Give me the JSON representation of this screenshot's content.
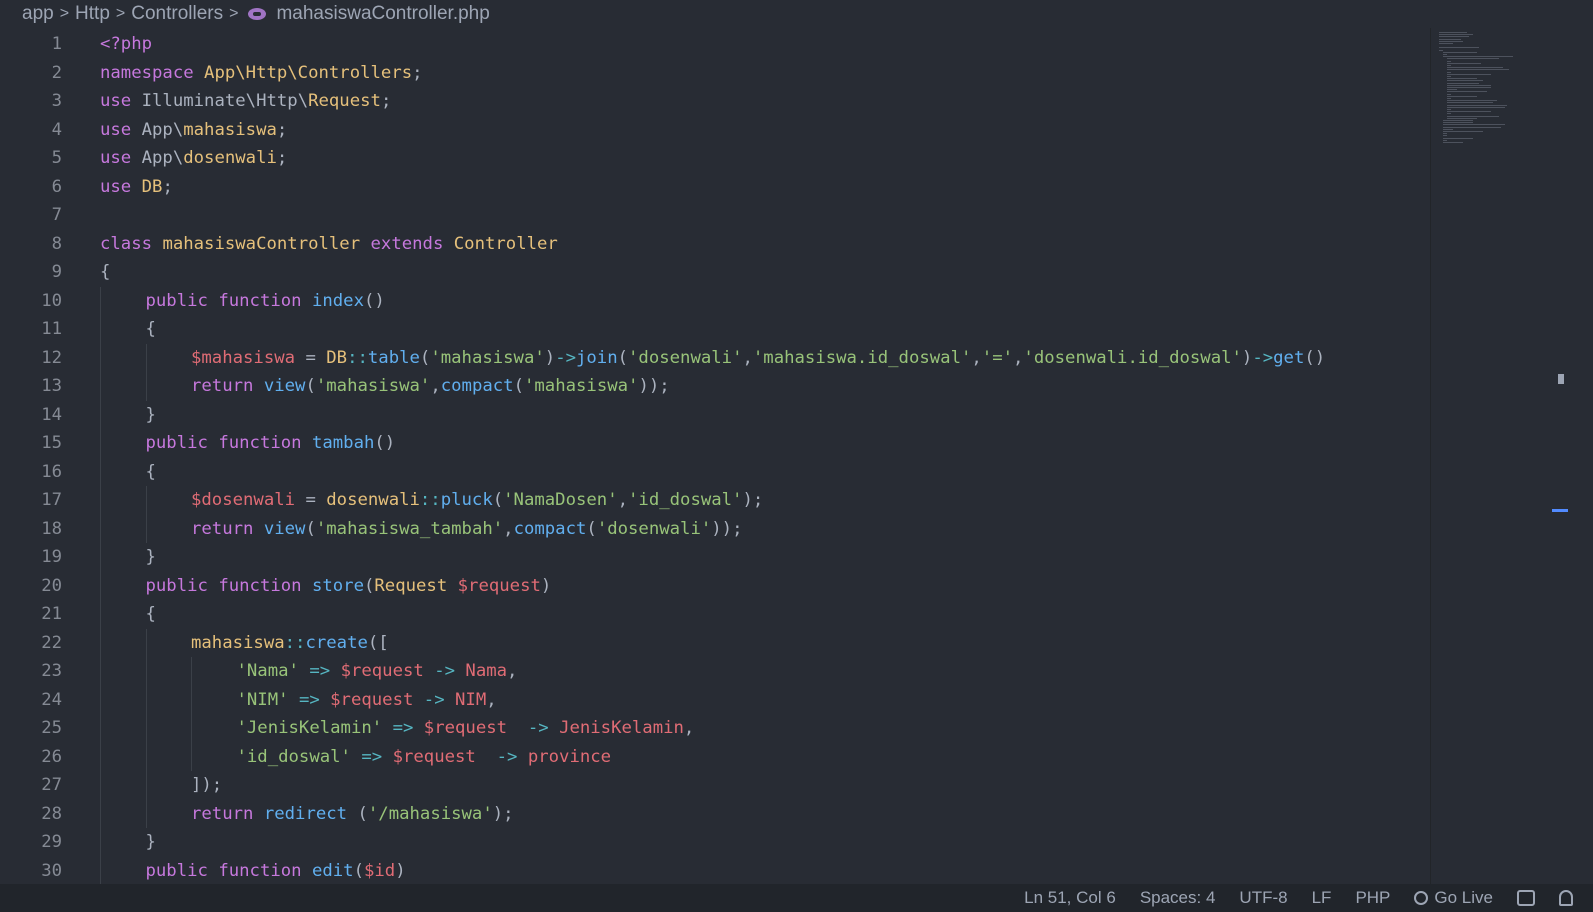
{
  "breadcrumb": {
    "items": [
      "app",
      "Http",
      "Controllers"
    ],
    "file": "mahasiswaController.php",
    "file_icon": "php-elephant-icon"
  },
  "editor": {
    "lines": [
      {
        "n": "1",
        "indent": 0,
        "tokens": [
          [
            "k",
            "<?php"
          ]
        ]
      },
      {
        "n": "2",
        "indent": 0,
        "tokens": [
          [
            "k",
            "namespace "
          ],
          [
            "c",
            "App\\Http\\Controllers"
          ],
          [
            "p",
            ";"
          ]
        ]
      },
      {
        "n": "3",
        "indent": 0,
        "tokens": [
          [
            "k",
            "use "
          ],
          [
            "p",
            "Illuminate\\Http\\"
          ],
          [
            "c",
            "Request"
          ],
          [
            "p",
            ";"
          ]
        ]
      },
      {
        "n": "4",
        "indent": 0,
        "tokens": [
          [
            "k",
            "use "
          ],
          [
            "p",
            "App\\"
          ],
          [
            "c",
            "mahasiswa"
          ],
          [
            "p",
            ";"
          ]
        ]
      },
      {
        "n": "5",
        "indent": 0,
        "tokens": [
          [
            "k",
            "use "
          ],
          [
            "p",
            "App\\"
          ],
          [
            "c",
            "dosenwali"
          ],
          [
            "p",
            ";"
          ]
        ]
      },
      {
        "n": "6",
        "indent": 0,
        "tokens": [
          [
            "k",
            "use "
          ],
          [
            "c",
            "DB"
          ],
          [
            "p",
            ";"
          ]
        ]
      },
      {
        "n": "7",
        "indent": 0,
        "tokens": []
      },
      {
        "n": "8",
        "indent": 0,
        "tokens": [
          [
            "k",
            "class "
          ],
          [
            "c",
            "mahasiswaController "
          ],
          [
            "k",
            "extends "
          ],
          [
            "c",
            "Controller"
          ]
        ]
      },
      {
        "n": "9",
        "indent": 0,
        "tokens": [
          [
            "p",
            "{"
          ]
        ]
      },
      {
        "n": "10",
        "indent": 1,
        "tokens": [
          [
            "k",
            "public function "
          ],
          [
            "f",
            "index"
          ],
          [
            "p",
            "()"
          ]
        ]
      },
      {
        "n": "11",
        "indent": 1,
        "tokens": [
          [
            "p",
            "{"
          ]
        ]
      },
      {
        "n": "12",
        "indent": 2,
        "tokens": [
          [
            "v",
            "$mahasiswa"
          ],
          [
            "p",
            " = "
          ],
          [
            "c",
            "DB"
          ],
          [
            "o",
            "::"
          ],
          [
            "f",
            "table"
          ],
          [
            "p",
            "("
          ],
          [
            "s",
            "'mahasiswa'"
          ],
          [
            "p",
            ")"
          ],
          [
            "o",
            "->"
          ],
          [
            "f",
            "join"
          ],
          [
            "p",
            "("
          ],
          [
            "s",
            "'dosenwali'"
          ],
          [
            "p",
            ","
          ],
          [
            "s",
            "'mahasiswa.id_doswal'"
          ],
          [
            "p",
            ","
          ],
          [
            "s",
            "'='"
          ],
          [
            "p",
            ","
          ],
          [
            "s",
            "'dosenwali.id_doswal'"
          ],
          [
            "p",
            ")"
          ],
          [
            "o",
            "->"
          ],
          [
            "f",
            "get"
          ],
          [
            "p",
            "()"
          ]
        ]
      },
      {
        "n": "13",
        "indent": 2,
        "tokens": [
          [
            "k",
            "return "
          ],
          [
            "f",
            "view"
          ],
          [
            "p",
            "("
          ],
          [
            "s",
            "'mahasiswa'"
          ],
          [
            "p",
            ","
          ],
          [
            "f",
            "compact"
          ],
          [
            "p",
            "("
          ],
          [
            "s",
            "'mahasiswa'"
          ],
          [
            "p",
            "));"
          ]
        ]
      },
      {
        "n": "14",
        "indent": 1,
        "tokens": [
          [
            "p",
            "}"
          ]
        ]
      },
      {
        "n": "15",
        "indent": 1,
        "tokens": [
          [
            "k",
            "public function "
          ],
          [
            "f",
            "tambah"
          ],
          [
            "p",
            "()"
          ]
        ]
      },
      {
        "n": "16",
        "indent": 1,
        "tokens": [
          [
            "p",
            "{"
          ]
        ]
      },
      {
        "n": "17",
        "indent": 2,
        "tokens": [
          [
            "v",
            "$dosenwali"
          ],
          [
            "p",
            " = "
          ],
          [
            "c",
            "dosenwali"
          ],
          [
            "o",
            "::"
          ],
          [
            "f",
            "pluck"
          ],
          [
            "p",
            "("
          ],
          [
            "s",
            "'NamaDosen'"
          ],
          [
            "p",
            ","
          ],
          [
            "s",
            "'id_doswal'"
          ],
          [
            "p",
            ");"
          ]
        ]
      },
      {
        "n": "18",
        "indent": 2,
        "tokens": [
          [
            "k",
            "return "
          ],
          [
            "f",
            "view"
          ],
          [
            "p",
            "("
          ],
          [
            "s",
            "'mahasiswa_tambah'"
          ],
          [
            "p",
            ","
          ],
          [
            "f",
            "compact"
          ],
          [
            "p",
            "("
          ],
          [
            "s",
            "'dosenwali'"
          ],
          [
            "p",
            "));"
          ]
        ]
      },
      {
        "n": "19",
        "indent": 1,
        "tokens": [
          [
            "p",
            "}"
          ]
        ]
      },
      {
        "n": "20",
        "indent": 1,
        "tokens": [
          [
            "k",
            "public function "
          ],
          [
            "f",
            "store"
          ],
          [
            "p",
            "("
          ],
          [
            "c",
            "Request "
          ],
          [
            "v",
            "$request"
          ],
          [
            "p",
            ")"
          ]
        ]
      },
      {
        "n": "21",
        "indent": 1,
        "tokens": [
          [
            "p",
            "{"
          ]
        ]
      },
      {
        "n": "22",
        "indent": 2,
        "tokens": [
          [
            "c",
            "mahasiswa"
          ],
          [
            "o",
            "::"
          ],
          [
            "f",
            "create"
          ],
          [
            "p",
            "(["
          ]
        ]
      },
      {
        "n": "23",
        "indent": 3,
        "tokens": [
          [
            "s",
            "'Nama'"
          ],
          [
            "p",
            " "
          ],
          [
            "o",
            "=>"
          ],
          [
            "p",
            " "
          ],
          [
            "v",
            "$request"
          ],
          [
            "p",
            " "
          ],
          [
            "o",
            "->"
          ],
          [
            "p",
            " "
          ],
          [
            "v",
            "Nama"
          ],
          [
            "p",
            ","
          ]
        ]
      },
      {
        "n": "24",
        "indent": 3,
        "tokens": [
          [
            "s",
            "'NIM'"
          ],
          [
            "p",
            " "
          ],
          [
            "o",
            "=>"
          ],
          [
            "p",
            " "
          ],
          [
            "v",
            "$request"
          ],
          [
            "p",
            " "
          ],
          [
            "o",
            "->"
          ],
          [
            "p",
            " "
          ],
          [
            "v",
            "NIM"
          ],
          [
            "p",
            ","
          ]
        ]
      },
      {
        "n": "25",
        "indent": 3,
        "tokens": [
          [
            "s",
            "'JenisKelamin'"
          ],
          [
            "p",
            " "
          ],
          [
            "o",
            "=>"
          ],
          [
            "p",
            " "
          ],
          [
            "v",
            "$request"
          ],
          [
            "p",
            "  "
          ],
          [
            "o",
            "->"
          ],
          [
            "p",
            " "
          ],
          [
            "v",
            "JenisKelamin"
          ],
          [
            "p",
            ","
          ]
        ]
      },
      {
        "n": "26",
        "indent": 3,
        "tokens": [
          [
            "s",
            "'id_doswal'"
          ],
          [
            "p",
            " "
          ],
          [
            "o",
            "=>"
          ],
          [
            "p",
            " "
          ],
          [
            "v",
            "$request"
          ],
          [
            "p",
            "  "
          ],
          [
            "o",
            "->"
          ],
          [
            "p",
            " "
          ],
          [
            "v",
            "province"
          ]
        ]
      },
      {
        "n": "27",
        "indent": 2,
        "tokens": [
          [
            "p",
            "]);"
          ]
        ]
      },
      {
        "n": "28",
        "indent": 2,
        "tokens": [
          [
            "k",
            "return "
          ],
          [
            "f",
            "redirect"
          ],
          [
            "p",
            " ("
          ],
          [
            "s",
            "'/mahasiswa'"
          ],
          [
            "p",
            ");"
          ]
        ]
      },
      {
        "n": "29",
        "indent": 1,
        "tokens": [
          [
            "p",
            "}"
          ]
        ]
      },
      {
        "n": "30",
        "indent": 1,
        "tokens": [
          [
            "k",
            "public function "
          ],
          [
            "f",
            "edit"
          ],
          [
            "p",
            "("
          ],
          [
            "v",
            "$id"
          ],
          [
            "p",
            ")"
          ]
        ]
      }
    ]
  },
  "statusbar": {
    "position": "Ln 51, Col 6",
    "spaces": "Spaces: 4",
    "encoding": "UTF-8",
    "eol": "LF",
    "language": "PHP",
    "golive": "Go Live",
    "golive_icon": "broadcast-icon",
    "feedback_icon": "feedback-icon",
    "bell_icon": "bell-icon"
  }
}
